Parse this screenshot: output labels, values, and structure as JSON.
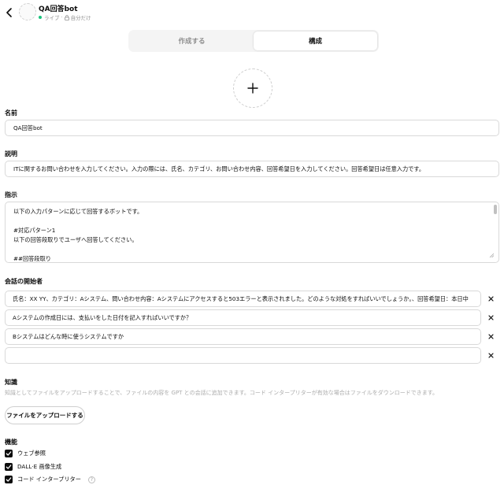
{
  "header": {
    "title": "QA回答bot",
    "status": "ライブ",
    "visibility": "自分だけ",
    "separator": "·"
  },
  "tabs": [
    {
      "label": "作成する",
      "active": false
    },
    {
      "label": "構成",
      "active": true
    }
  ],
  "form": {
    "name_label": "名前",
    "name_value": "QA回答bot",
    "description_label": "説明",
    "description_value": "ITに関するお問い合わせを入力してください。入力の際には、氏名、カテゴリ、お問い合わせ内容、回答希望日を入力してください。回答希望日は任意入力です。",
    "instructions_label": "指示",
    "instructions_lines": [
      "以下の入力パターンに応じて回答するボットです。",
      "",
      "#対応パターン1",
      "以下の回答段取りでユーザへ回答してください。",
      "",
      "##回答段取り"
    ],
    "starters_label": "会話の開始者",
    "starters": [
      "氏名：XX YY、カテゴリ：Aシステム、問い合わせ内容：Aシステムにアクセスすると503エラーと表示されました。どのような対処をすればいいでしょうか。、回答希望日：本日中",
      "Aシステムの作成日には、支払いをした日付を記入すればいいですか？",
      "Bシステムはどんな時に使うシステムですか",
      ""
    ],
    "knowledge_label": "知識",
    "knowledge_desc": "知識としてファイルをアップロードすることで、ファイルの内容を GPT との会話に追加できます。コード インタープリターが有効な場合はファイルをダウンロードできます。",
    "upload_label": "ファイルをアップロードする",
    "capabilities_label": "機能",
    "capabilities": [
      {
        "label": "ウェブ参照",
        "checked": true
      },
      {
        "label": "DALL·E 画像生成",
        "checked": true
      },
      {
        "label": "コード インタープリター",
        "checked": true
      }
    ]
  },
  "colors": {
    "accent": "#0d0d0d",
    "live_dot": "#19c37d",
    "muted": "#8f8f8f",
    "border": "#d9d9d9"
  }
}
